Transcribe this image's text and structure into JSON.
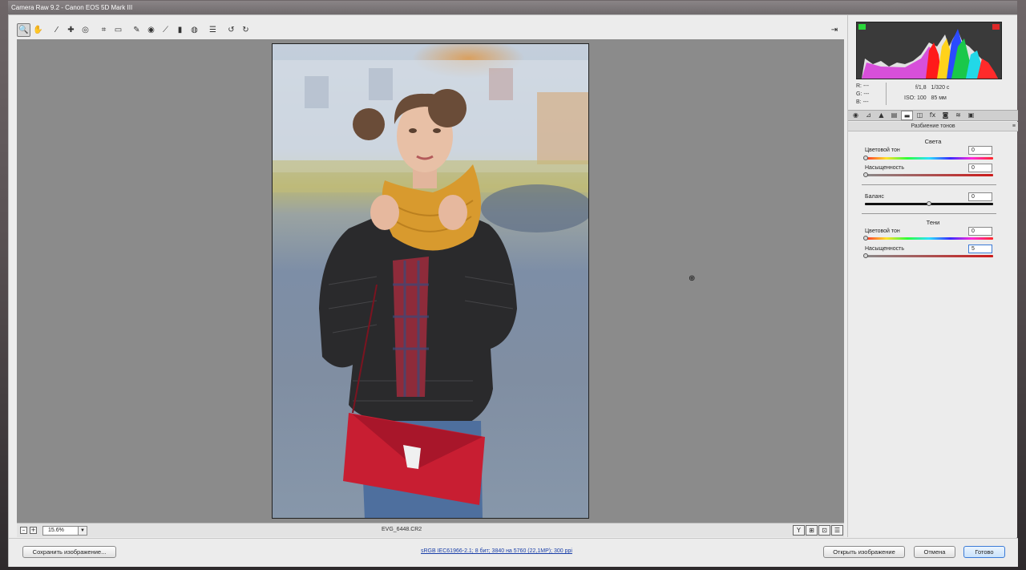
{
  "title": "Camera Raw 9.2  -  Canon EOS 5D Mark III",
  "toolbar": {
    "tools": [
      {
        "name": "zoom-tool",
        "glyph": "🔍",
        "active": true
      },
      {
        "name": "hand-tool",
        "glyph": "✋"
      },
      {
        "name": "white-balance-tool",
        "glyph": "⁄"
      },
      {
        "name": "color-sampler-tool",
        "glyph": "✚"
      },
      {
        "name": "targeted-adjustment-tool",
        "glyph": "◎"
      },
      {
        "name": "crop-tool",
        "glyph": "⌗"
      },
      {
        "name": "straighten-tool",
        "glyph": "▭"
      },
      {
        "name": "spot-removal-tool",
        "glyph": "✎"
      },
      {
        "name": "red-eye-removal-tool",
        "glyph": "◉"
      },
      {
        "name": "adjustment-brush-tool",
        "glyph": "⟋"
      },
      {
        "name": "graduated-filter-tool",
        "glyph": "▮"
      },
      {
        "name": "radial-filter-tool",
        "glyph": "◍"
      },
      {
        "name": "preferences-tool",
        "glyph": "☰"
      },
      {
        "name": "rotate-left-tool",
        "glyph": "↺"
      },
      {
        "name": "rotate-right-tool",
        "glyph": "↻"
      }
    ],
    "open_prefs_glyph": "⇥"
  },
  "status": {
    "zoom_value": "15.6%",
    "filename": "EVG_6448.CR2",
    "view_buttons": [
      "Y",
      "⊞",
      "⊡",
      "☰"
    ]
  },
  "panel": {
    "rgb": {
      "r_label": "R:",
      "r": "---",
      "g_label": "G:",
      "g": "---",
      "b_label": "B:",
      "b": "---"
    },
    "exif": {
      "aperture": "f/1,8",
      "shutter": "1/320 с",
      "iso": "ISO: 100",
      "focal": "85 мм"
    },
    "tabs": [
      "◉",
      "⊿",
      "▲",
      "▤",
      "▬",
      "◫",
      "fx",
      "◙",
      "≋",
      "▣"
    ],
    "section_title": "Разбиение тонов",
    "highlights": {
      "title": "Света",
      "hue_label": "Цветовой тон",
      "hue_value": "0",
      "sat_label": "Насыщенность",
      "sat_value": "0"
    },
    "balance": {
      "label": "Баланс",
      "value": "0"
    },
    "shadows": {
      "title": "Тени",
      "hue_label": "Цветовой тон",
      "hue_value": "0",
      "sat_label": "Насыщенность",
      "sat_value": "5"
    }
  },
  "buttons": {
    "save": "Сохранить изображение...",
    "workflow": "sRGB IEC61966-2.1; 8 бит; 3840 на 5760 (22,1MP); 300 ppi",
    "open": "Открыть изображение",
    "cancel": "Отмена",
    "done": "Готово"
  }
}
